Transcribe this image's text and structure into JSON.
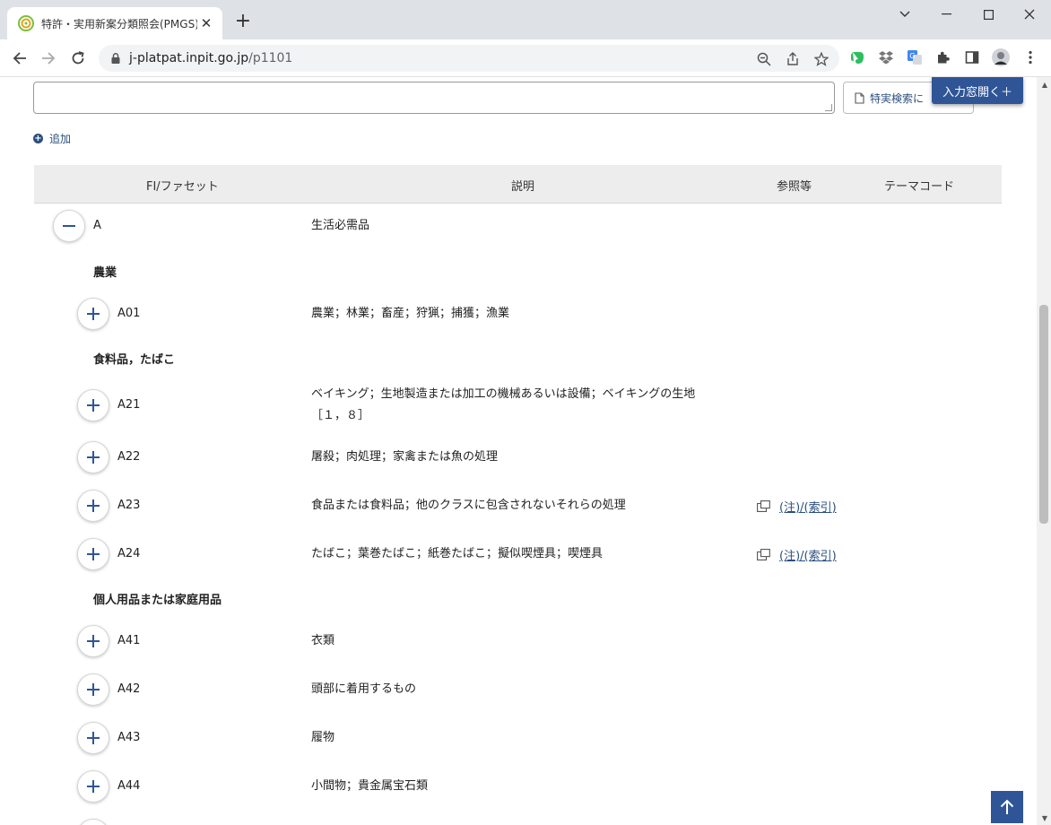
{
  "browser": {
    "tab_title": "特許・実用新案分類照会(PMGS) | J-PlatPat",
    "new_tab": "+",
    "url_host": "j-platpat.inpit.go.jp",
    "url_path": "/p1101",
    "icons": [
      "zoom-out-icon",
      "share-icon",
      "star-icon",
      "evernote-icon",
      "dropbox-icon",
      "translate-icon",
      "puzzle-icon",
      "sidepanel-icon",
      "avatar",
      "menu-icon"
    ]
  },
  "page": {
    "search_button_label": "特実検索に",
    "open_window_label": "入力窓開く＋",
    "add_label": "追加",
    "headers": {
      "fi": "FI/ファセット",
      "desc": "説明",
      "ref": "参照等",
      "theme": "テーマコード"
    },
    "top": {
      "code": "A",
      "desc": "生活必需品"
    },
    "groups": [
      {
        "label": "農業"
      },
      {
        "label": "食料品，たばこ"
      },
      {
        "label": "個人用品または家庭用品"
      }
    ],
    "rows": [
      {
        "code": "A01",
        "desc": "農業；林業；畜産；狩猟；捕獲；漁業"
      },
      {
        "code": "A21",
        "desc": "ベイキング；生地製造または加工の機械あるいは設備；ベイキングの生地［１，８］"
      },
      {
        "code": "A22",
        "desc": "屠殺；肉処理；家禽または魚の処理"
      },
      {
        "code": "A23",
        "desc": "食品または食料品；他のクラスに包含されないそれらの処理",
        "ref": "(注)/(索引)"
      },
      {
        "code": "A24",
        "desc": "たばこ；葉巻たばこ；紙巻たばこ；擬似喫煙具；喫煙具",
        "ref": "(注)/(索引)"
      },
      {
        "code": "A41",
        "desc": "衣類"
      },
      {
        "code": "A42",
        "desc": "頭部に着用するもの"
      },
      {
        "code": "A43",
        "desc": "履物"
      },
      {
        "code": "A44",
        "desc": "小間物；貴金属宝石類"
      }
    ]
  }
}
